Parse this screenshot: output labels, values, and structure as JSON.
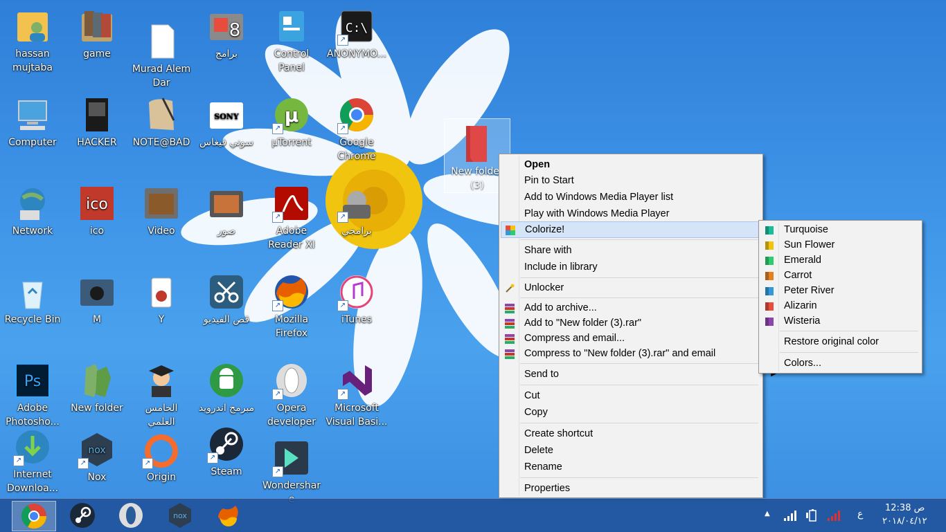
{
  "desktop_icons": [
    {
      "label": "hassan mujtaba",
      "icon": "user-folder-icon",
      "shortcut": false
    },
    {
      "label": "game",
      "icon": "game-folder-icon",
      "shortcut": false
    },
    {
      "label": "Murad Alem Dar",
      "icon": "document-icon",
      "shortcut": false
    },
    {
      "label": "برامج",
      "icon": "windows8-folder-icon",
      "shortcut": false
    },
    {
      "label": "Control Panel",
      "icon": "control-panel-icon",
      "shortcut": false
    },
    {
      "label": "ANONYMO...",
      "icon": "cmd-icon",
      "shortcut": true
    },
    {
      "label": "Computer",
      "icon": "computer-icon",
      "shortcut": false
    },
    {
      "label": "HACKER",
      "icon": "book-icon",
      "shortcut": false
    },
    {
      "label": "NOTE@BAD",
      "icon": "notepad-icon",
      "shortcut": false
    },
    {
      "label": "سوني فيغاس",
      "icon": "sony-folder-icon",
      "shortcut": false
    },
    {
      "label": "µTorrent",
      "icon": "utorrent-icon",
      "shortcut": true
    },
    {
      "label": "Google Chrome",
      "icon": "chrome-icon",
      "shortcut": true
    },
    {
      "label": "Network",
      "icon": "network-icon",
      "shortcut": false
    },
    {
      "label": "ico",
      "icon": "ico-icon",
      "shortcut": false
    },
    {
      "label": "Video",
      "icon": "video-folder-icon",
      "shortcut": false
    },
    {
      "label": "صور",
      "icon": "pictures-folder-icon",
      "shortcut": false
    },
    {
      "label": "Adobe Reader XI",
      "icon": "adobe-reader-icon",
      "shortcut": true
    },
    {
      "label": "برامجي",
      "icon": "my-programs-icon",
      "shortcut": true
    },
    {
      "label": "Recycle Bin",
      "icon": "recycle-bin-icon",
      "shortcut": false
    },
    {
      "label": "M",
      "icon": "music-folder-icon",
      "shortcut": false
    },
    {
      "label": "Y",
      "icon": "trash-folder-icon",
      "shortcut": false
    },
    {
      "label": "قص الفيديو",
      "icon": "scissors-icon",
      "shortcut": false
    },
    {
      "label": "Mozilla Firefox",
      "icon": "firefox-icon",
      "shortcut": true
    },
    {
      "label": "iTunes",
      "icon": "itunes-icon",
      "shortcut": true
    },
    {
      "label": "Adobe Photosho...",
      "icon": "photoshop-icon",
      "shortcut": false
    },
    {
      "label": "New folder",
      "icon": "green-folder-icon",
      "shortcut": false
    },
    {
      "label": "الخامس العلمي",
      "icon": "graduate-icon",
      "shortcut": false
    },
    {
      "label": "مبرمج اندرويد",
      "icon": "android-icon",
      "shortcut": false
    },
    {
      "label": "Opera developer",
      "icon": "opera-icon",
      "shortcut": true
    },
    {
      "label": "Microsoft Visual Basi...",
      "icon": "visual-studio-icon",
      "shortcut": true
    },
    {
      "label": "Internet Downloa...",
      "icon": "idm-icon",
      "shortcut": true
    },
    {
      "label": "Nox",
      "icon": "nox-icon",
      "shortcut": true
    },
    {
      "label": "Origin",
      "icon": "origin-icon",
      "shortcut": true
    },
    {
      "label": "Steam",
      "icon": "steam-icon",
      "shortcut": true
    },
    {
      "label": "Wondershare",
      "icon": "wondershare-icon",
      "shortcut": true
    }
  ],
  "selected_folder": {
    "label": "New folder (3)",
    "color": "#e04848"
  },
  "context_menu": {
    "open": "Open",
    "pin_to_start": "Pin to Start",
    "add_wmp_list": "Add to Windows Media Player list",
    "play_wmp": "Play with Windows Media Player",
    "colorize": "Colorize!",
    "share_with": "Share with",
    "include_library": "Include in library",
    "unlocker": "Unlocker",
    "add_archive": "Add to archive...",
    "add_rar": "Add to \"New folder (3).rar\"",
    "compress_email": "Compress and email...",
    "compress_rar_email": "Compress to \"New folder (3).rar\" and email",
    "send_to": "Send to",
    "cut": "Cut",
    "copy": "Copy",
    "create_shortcut": "Create shortcut",
    "delete": "Delete",
    "rename": "Rename",
    "properties": "Properties",
    "submenu_arrow": "▶"
  },
  "colorize_submenu": {
    "colors": [
      {
        "label": "Turquoise",
        "color": "#1abc9c"
      },
      {
        "label": "Sun Flower",
        "color": "#f1c40f"
      },
      {
        "label": "Emerald",
        "color": "#2ecc71"
      },
      {
        "label": "Carrot",
        "color": "#e67e22"
      },
      {
        "label": "Peter River",
        "color": "#3498db"
      },
      {
        "label": "Alizarin",
        "color": "#e74c3c"
      },
      {
        "label": "Wisteria",
        "color": "#8e44ad"
      }
    ],
    "restore": "Restore original color",
    "colors_more": "Colors..."
  },
  "taskbar": {
    "pinned": [
      "chrome-icon",
      "steam-icon",
      "opera-icon",
      "nox-icon",
      "firefox-icon"
    ],
    "tray": {
      "lang": "ع",
      "time": "12:38 ص",
      "date": "٢٠١٨/٠٤/١٢",
      "show_hidden": "▲"
    }
  }
}
